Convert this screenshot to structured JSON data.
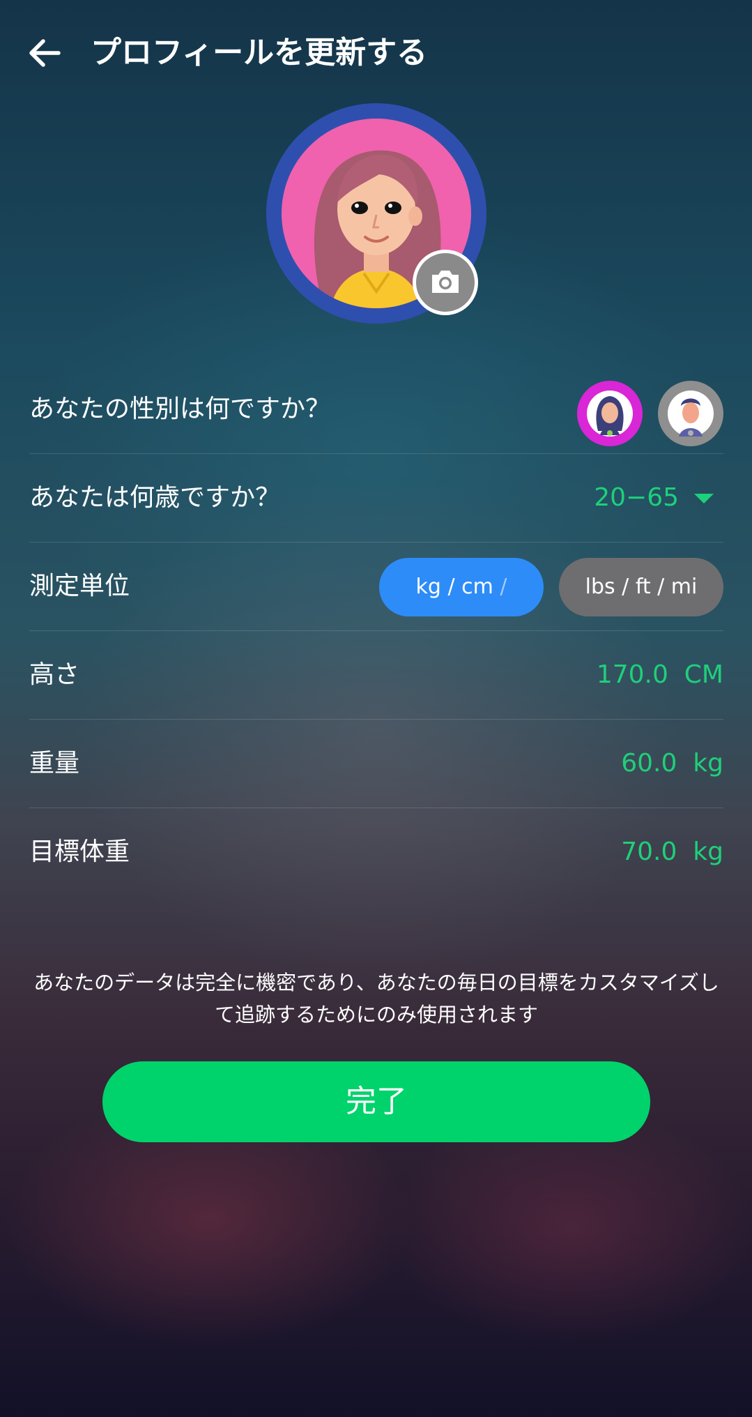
{
  "header": {
    "title": "プロフィールを更新する",
    "back_icon": "arrow-left-icon"
  },
  "profile": {
    "avatar_icon": "female-avatar-illustration",
    "camera_icon": "camera-icon"
  },
  "form": {
    "gender": {
      "label": "あなたの性別は何ですか？",
      "options": [
        "female-avatar-icon",
        "male-avatar-icon"
      ],
      "selected": "female"
    },
    "age": {
      "label": "あなたは何歳ですか？",
      "value": "20−65",
      "dropdown_icon": "triangle-down-icon"
    },
    "units": {
      "label": "測定単位",
      "option_metric_main": "kg / cm",
      "option_metric_faint": " /",
      "option_imperial": "lbs / ft / mi",
      "selected": "metric"
    },
    "height": {
      "label": "高さ",
      "value": "170.0",
      "unit": "CM"
    },
    "weight": {
      "label": "重量",
      "value": "60.0",
      "unit": "kg"
    },
    "target_weight": {
      "label": "目標体重",
      "value": "70.0",
      "unit": "kg"
    }
  },
  "notice": "あなたのデータは完全に機密であり、あなたの毎日の目標をカスタマイズして追跡するためにのみ使用されます",
  "done_button": "完了",
  "colors": {
    "accent_green": "#1ed07a",
    "button_green": "#00d36b",
    "selected_blue": "#2d8cf8",
    "unselected_gray": "#6e6e70",
    "avatar_ring": "#2f4fae",
    "avatar_bg": "#f062ad"
  }
}
